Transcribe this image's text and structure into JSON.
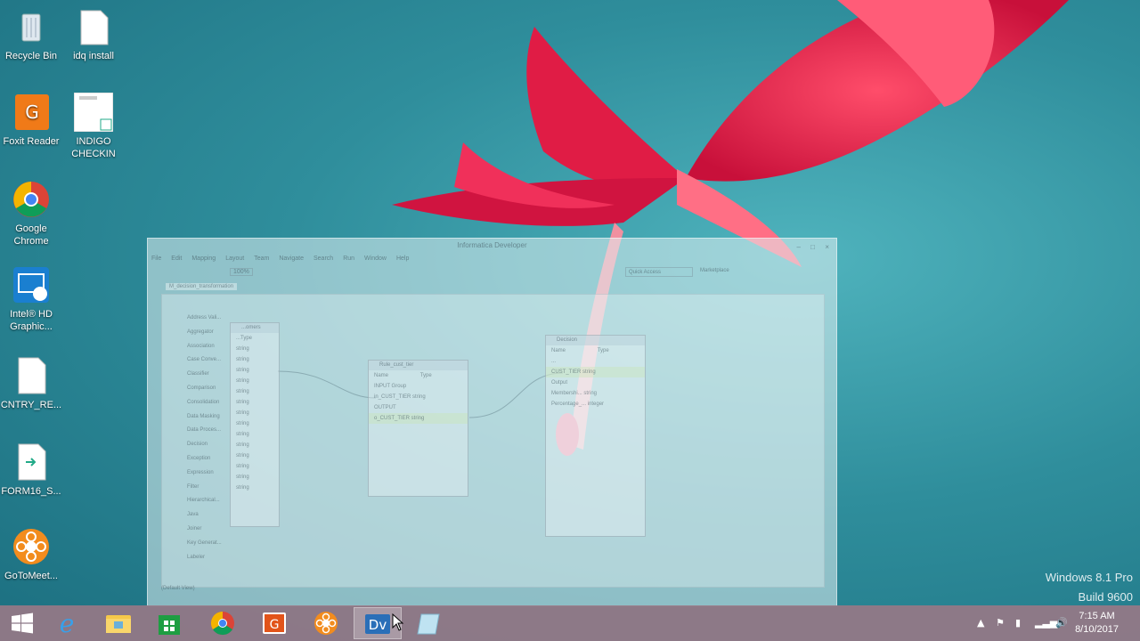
{
  "desktop": {
    "icons": [
      {
        "label": "Recycle Bin",
        "icon": "recycle-bin-icon"
      },
      {
        "label": "idq install",
        "icon": "text-file-icon"
      },
      {
        "label": "Foxit Reader",
        "icon": "foxit-reader-icon"
      },
      {
        "label": "INDIGO CHECKIN",
        "icon": "document-thumbnail-icon"
      },
      {
        "label": "Google Chrome",
        "icon": "chrome-icon"
      },
      {
        "label": "Intel® HD Graphic...",
        "icon": "intel-graphics-icon"
      },
      {
        "label": "CNTRY_RE...",
        "icon": "text-file-icon"
      },
      {
        "label": "FORM16_S...",
        "icon": "form-file-icon"
      },
      {
        "label": "GoToMeet...",
        "icon": "gotomeeting-icon"
      }
    ]
  },
  "window": {
    "title": "Informatica Developer",
    "menu": [
      "File",
      "Edit",
      "Mapping",
      "Layout",
      "Team",
      "Navigate",
      "Search",
      "Run",
      "Window",
      "Help"
    ],
    "zoom": "100%",
    "quick_access_placeholder": "Quick Access",
    "marketplace_label": "Marketplace",
    "editor_tab": "M_decision_transformation",
    "palette": [
      "Address Vali...",
      "Aggregator",
      "Association",
      "Case Conve...",
      "Classifier",
      "Comparison",
      "Consolidation",
      "Data Masking",
      "Data Proces...",
      "Decision",
      "Exception",
      "Expression",
      "Filter",
      "Hierarchical...",
      "Java",
      "Joiner",
      "Key Generat...",
      "Labeler"
    ],
    "customers_box": {
      "title": "...omers",
      "col": "...Type",
      "types": [
        "string",
        "string",
        "string",
        "string",
        "string",
        "string",
        "string",
        "string",
        "string",
        "string",
        "string",
        "string",
        "string",
        "string"
      ]
    },
    "rule_box": {
      "title": "Rule_cust_tier",
      "cols": [
        "Name",
        "Type"
      ],
      "rows": [
        "INPUT Group",
        "in_CUST_TIER   string",
        "OUTPUT",
        "o_CUST_TIER   string"
      ]
    },
    "decision_box": {
      "title": "Decision",
      "cols": [
        "Name",
        "Type"
      ],
      "rows": [
        "...",
        "CUST_TIER   string",
        "Output",
        "Membershi...   string",
        "Percentage_...   integer"
      ]
    },
    "status": "(Default View)"
  },
  "watermark": {
    "line1": "Windows 8.1 Pro",
    "line2": "Build 9600"
  },
  "taskbar": {
    "buttons": [
      {
        "name": "start-button",
        "icon": "windows-logo-icon"
      },
      {
        "name": "internet-explorer-button",
        "icon": "ie-icon"
      },
      {
        "name": "file-explorer-button",
        "icon": "folder-icon"
      },
      {
        "name": "store-button",
        "icon": "store-icon"
      },
      {
        "name": "chrome-button",
        "icon": "chrome-icon"
      },
      {
        "name": "foxit-button",
        "icon": "foxit-icon"
      },
      {
        "name": "gotomeeting-button",
        "icon": "gotomeeting-icon"
      },
      {
        "name": "informatica-developer-button",
        "icon": "dv-icon",
        "label": "Dv",
        "active": true
      },
      {
        "name": "notebook-button",
        "icon": "notebook-icon"
      }
    ],
    "clock": {
      "time": "7:15 AM",
      "date": "8/10/2017"
    }
  }
}
